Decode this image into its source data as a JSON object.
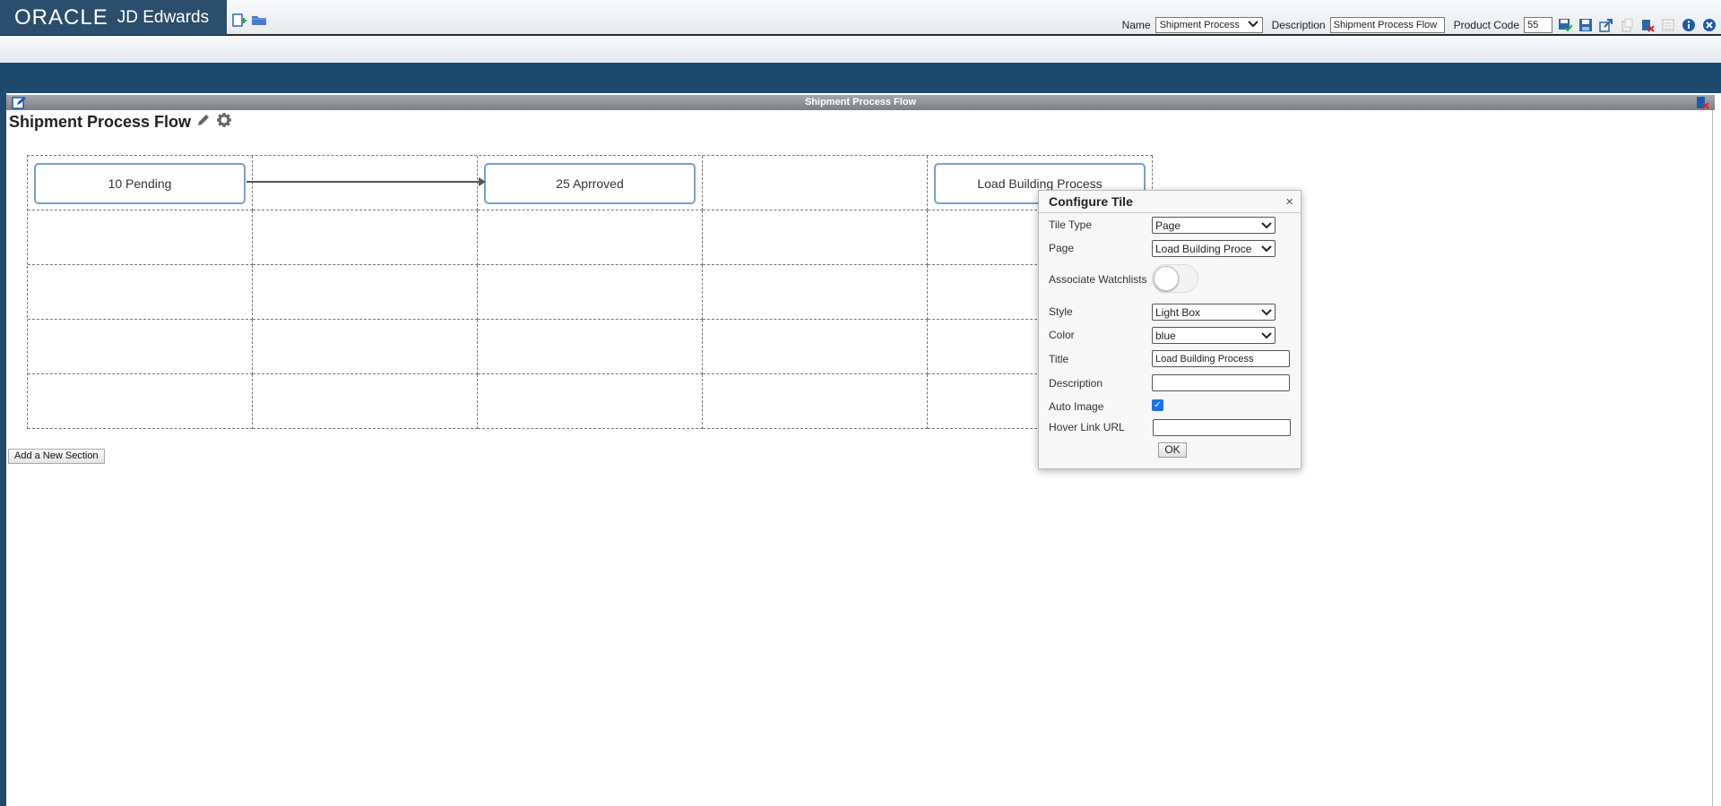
{
  "header": {
    "logo_oracle": "ORACLE",
    "logo_product": "JD Edwards",
    "name_label": "Name",
    "name_value": "Shipment Process",
    "description_label": "Description",
    "description_value": "Shipment Process Flow",
    "product_code_label": "Product Code",
    "product_code_value": "55"
  },
  "panel": {
    "window_title": "Shipment Process Flow",
    "page_title": "Shipment Process Flow"
  },
  "tiles": [
    {
      "label": "10 Pending"
    },
    {
      "label": "25 Aprroved"
    },
    {
      "label": "Load Building Process"
    }
  ],
  "add_section_label": "Add a New Section",
  "dialog": {
    "title": "Configure Tile",
    "close": "×",
    "tile_type_label": "Tile Type",
    "tile_type_value": "Page",
    "page_label": "Page",
    "page_value": "Load Building Proce",
    "watchlists_label": "Associate Watchlists",
    "watchlists_on": false,
    "style_label": "Style",
    "style_value": "Light Box",
    "color_label": "Color",
    "color_value": "blue",
    "title_label": "Title",
    "title_value": "Load Building Process",
    "description_label": "Description",
    "description_value": "",
    "auto_image_label": "Auto Image",
    "auto_image_checked": true,
    "hover_label": "Hover Link URL",
    "hover_value": "",
    "ok_label": "OK"
  },
  "colors": {
    "brand": "#2a4e6c",
    "nav": "#1e4a6e",
    "tile_border": "#7a9ecf",
    "checkbox": "#1a73e8"
  }
}
